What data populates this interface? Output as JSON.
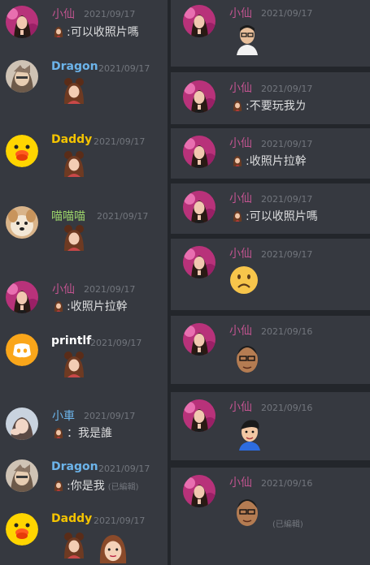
{
  "colors": {
    "xiaoxian": "#c0548f",
    "dragon": "#6cb4ea",
    "daddy": "#f5c400",
    "miao": "#9bd36a",
    "printlf": "#ffffff",
    "xiaoche": "#6cb4ea"
  },
  "left": [
    {
      "author": "小仙",
      "time": "2021/09/17",
      "text": ":可以收照片嗎"
    },
    {
      "author": "Dragon",
      "time": "2021/09/17"
    },
    {
      "author": "Daddy",
      "time": "2021/09/17"
    },
    {
      "author": "喵喵喵",
      "time": "2021/09/17"
    },
    {
      "author": "小仙",
      "time": "2021/09/17",
      "text": ":收照片拉幹"
    },
    {
      "author": "printlf",
      "time": "2021/09/17"
    },
    {
      "author": "小車",
      "time": "2021/09/17",
      "text": "：我是誰"
    },
    {
      "author": "Dragon",
      "time": "2021/09/17",
      "text": ":你是我",
      "edited": "(已編輯)"
    },
    {
      "author": "Daddy",
      "time": "2021/09/17"
    }
  ],
  "right": [
    {
      "author": "小仙",
      "time": "2021/09/17"
    },
    {
      "author": "小仙",
      "time": "2021/09/17",
      "text": ":不要玩我ㄌ"
    },
    {
      "author": "小仙",
      "time": "2021/09/17",
      "text": ":收照片拉幹"
    },
    {
      "author": "小仙",
      "time": "2021/09/17",
      "text": ":可以收照片嗎"
    },
    {
      "author": "小仙",
      "time": "2021/09/17"
    },
    {
      "author": "小仙",
      "time": "2021/09/16"
    },
    {
      "author": "小仙",
      "time": "2021/09/16"
    },
    {
      "author": "小仙",
      "time": "2021/09/16",
      "edited": "(已編輯)"
    }
  ]
}
